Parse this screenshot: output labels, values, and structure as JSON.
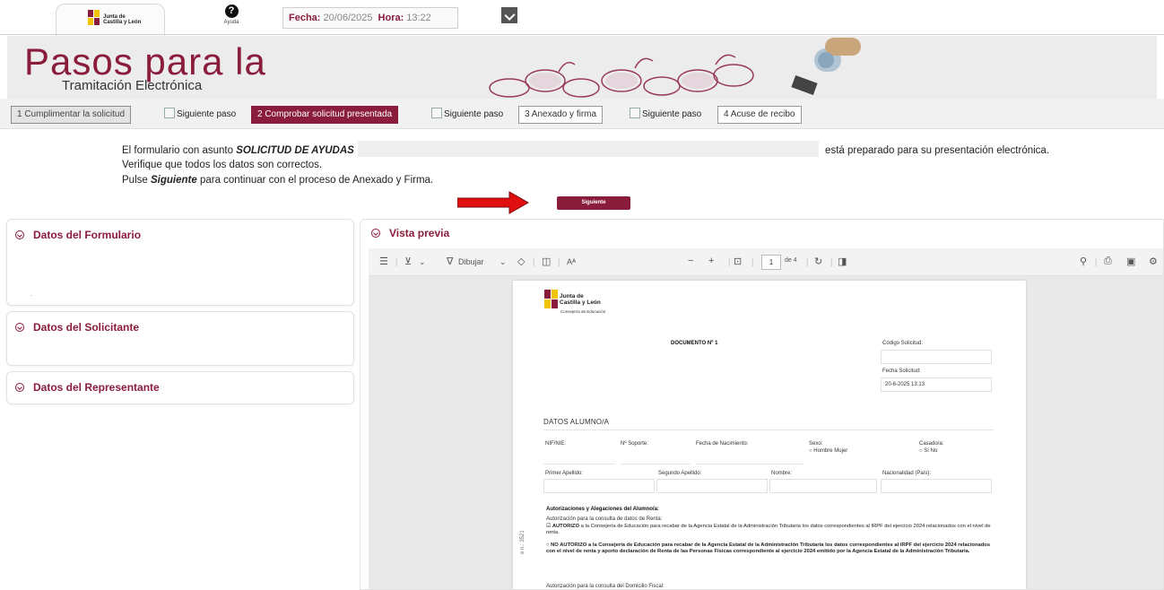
{
  "topbar": {
    "logo_line1": "Junta de",
    "logo_line2": "Castilla y León",
    "help_label": "Ayuda",
    "date_label": "Fecha:",
    "date_value": "20/06/2025",
    "time_label": "Hora:",
    "time_value": "13:22"
  },
  "banner": {
    "title": "Pasos para la",
    "subtitle": "Tramitación Electrónica"
  },
  "steps": {
    "step1": "1 Cumplimentar la solicitud",
    "next1": "Siguiente paso",
    "step2": "2 Comprobar solicitud presentada",
    "next2": "Siguiente paso",
    "step3": "3 Anexado y firma",
    "next3": "Siguiente paso",
    "step4": "4 Acuse de recibo"
  },
  "message": {
    "part1": "El formulario con asunto",
    "subject": "SOLICITUD DE AYUDAS",
    "part2": "está preparado para su presentación electrónica. Verifique que todos los datos son correctos.",
    "line2_pre": "Pulse",
    "line2_bold": "Siguiente",
    "line2_post": "para continuar con el proceso de Anexado y Firma.",
    "button": "Siguiente"
  },
  "panels": {
    "formulario": "Datos del Formulario",
    "formulario_dot": ".",
    "solicitante": "Datos del Solicitante",
    "representante": "Datos del Representante"
  },
  "preview": {
    "title": "Vista previa",
    "toolbar": {
      "draw": "Dibujar",
      "page": "1",
      "of_pages": "de 4"
    },
    "doc": {
      "logo_line1": "Junta de",
      "logo_line2": "Castilla y León",
      "logo_sub": "Consejería de Educación",
      "doc_title": "DOCUMENTO Nº 1",
      "codigo_label": "Código Solicitud:",
      "fecha_label": "Fecha Solicitud:",
      "fecha_value": "20-6-2025 13:13",
      "section_alumno": "DATOS ALUMNO/A",
      "nif": "NIF/NIE:",
      "soporte": "Nº Soporte:",
      "nacimiento": "Fecha de Nacimiento:",
      "sexo": "Sexo:",
      "sexo_opts": "Hombre   Mujer",
      "casado": "Casado/a:",
      "casado_opts": "Sí   No",
      "apellido1": "Primer Apellido:",
      "apellido2": "Segundo Apellido:",
      "nombre": "Nombre:",
      "nacionalidad": "Nacionalidad (País):",
      "autoriz_title": "Autorizaciones y Alegaciones del Alumno/a:",
      "autoriz_sub": "Autorización para la consulta de datos de Renta:",
      "autoriz_p1_bold": "AUTORIZO",
      "autoriz_p1": "a la Consejería de Educación para recabar de la Agencia Estatal de la Administración Tributaria los datos correspondientes al IRPF del ejercicio 2024 relacionados con el nivel de renta.",
      "autoriz_p2_bold": "NO AUTORIZO",
      "autoriz_p2": "a la Consejería de Educación para recabar de la Agencia Estatal de la Administración Tributaria los datos correspondientes al IRPF del ejercicio 2024 relacionados con el nivel de renta y aporto declaración de Renta de las Personas Físicas correspondiente al ejercicio 2024 emitido por la Agencia Estatal de la Administración Tributaria.",
      "domicilio": "Autorización para la consulta del Domicilio Fiscal:",
      "side_id": "e n.: 3521"
    }
  },
  "colors": {
    "brand": "#8a1c3c",
    "arrow": "#e01010"
  }
}
